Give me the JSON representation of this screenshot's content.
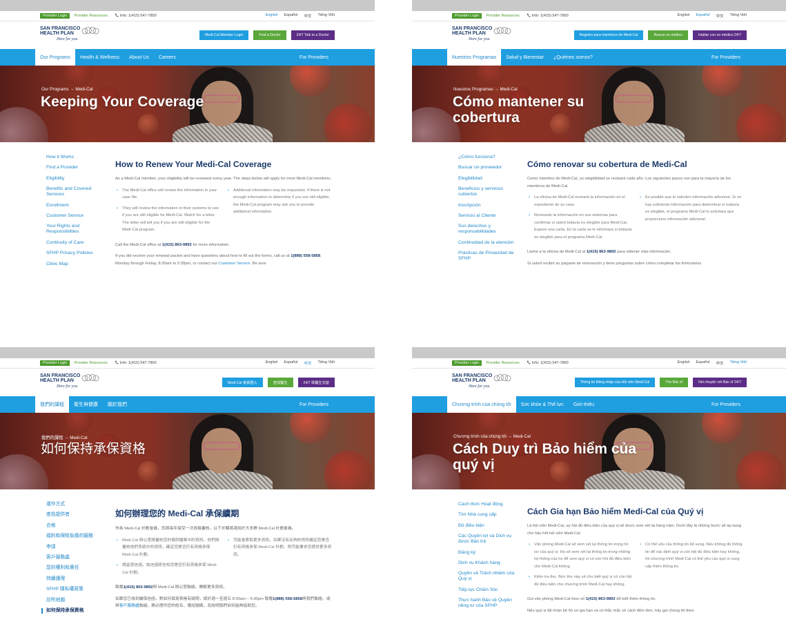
{
  "colors": {
    "brand_blue": "#1f9ee0",
    "brand_green": "#5aa83a",
    "brand_purple": "#5b2d86",
    "heading_navy": "#1b3a6b"
  },
  "icons": {
    "phone": "phone-icon",
    "logo": "sfhp-logo-icon"
  },
  "logo": {
    "line1": "SAN FRANCISCO",
    "line2": "HEALTH PLAN",
    "tagline": "Here for you"
  },
  "panels": [
    {
      "util": {
        "login": "Provider Login",
        "resources": "Provider Resources",
        "phone": "Info: 1(415) 547-7800",
        "langs": [
          "English",
          "Español",
          "中文",
          "Tiếng Việt"
        ],
        "active_lang": 0
      },
      "buttons": [
        "Medi-Cal Member Login",
        "Find a Doctor",
        "24/7 Talk to a Doctor"
      ],
      "nav": [
        "Our Programs",
        "Health & Wellness",
        "About Us",
        "Careers"
      ],
      "providers": "For Providers",
      "breadcrumb": "Our Programs → Medi-Cal",
      "title": "Keeping Your Coverage",
      "sidebar": [
        "How it Works",
        "Find a Provider",
        "Eligibility",
        "Benefits and Covered Services",
        "Enrollment",
        "Customer Service",
        "Your Rights and Responsibilities",
        "Continuity of Care",
        "SFHP Privacy Policies",
        "Clinic Map"
      ],
      "heading": "How to Renew Your Medi-Cal Coverage",
      "intro": "As a Medi-Cal member, your eligibility will be reviewed every year. The steps below will apply for most Medi-Cal members.",
      "bullets_left": [
        "The Medi-Cal office will review the information in your case file.",
        "They will review the information in their systems to see if you are still eligible for Medi-Cal. Watch for a letter. The letter will tell you if you are still eligible for the Medi-Cal program."
      ],
      "bullets_right": [
        "Additional information may be requested. If there is not enough information to determine if you are still eligible, the Medi-Cal program may ask you to provide additional information."
      ],
      "call_before": "Call the Medi-Cal office at ",
      "call_phone": "1(415) 863-9892",
      "call_after": " for more information.",
      "renew_before": "If you did receive your renewal packet and have questions about how to fill out the forms, call us at ",
      "renew_phone": "1(888) 558-5858",
      "renew_mid": ", Monday through Friday, 8:30am to 5:30pm, or contact our ",
      "renew_link": "Customer Service",
      "renew_after": ". Be sure"
    },
    {
      "util": {
        "login": "Provider Login",
        "resources": "Provider Resources",
        "phone": "Info: 1(415) 547-7800",
        "langs": [
          "English",
          "Español",
          "中文",
          "Tiếng Việt"
        ],
        "active_lang": 1
      },
      "buttons": [
        "Registro para miembros de Medi-Cal",
        "Buscar un médico",
        "Hablar con un médico 24/7"
      ],
      "nav": [
        "Nuestros Programas",
        "Salud y Bienestar",
        "¿Quiénes somos?"
      ],
      "providers": "For Providers",
      "breadcrumb": "Nuestros Programas → Medi-Cal",
      "title": "Cómo mantener su cobertura",
      "sidebar": [
        "¿Cómo funciona?",
        "Buscar un proveedor",
        "Elegibilidad",
        "Beneficios y servicios cubiertos",
        "Inscripción",
        "Servicio al Cliente",
        "Sus derechos y responsabilidades",
        "Continuidad de la atención",
        "Prácticas de Privacidad de SFHP"
      ],
      "heading": "Cómo renovar su cobertura de Medi-Cal",
      "intro": "Como miembro de Medi-Cal, su elegibilidad se revisará cada año. Los siguientes pasos son para la mayoría de los miembros de Medi-Cal.",
      "bullets_left": [
        "La oficina de Medi-Cal revisará la información en el expediente de su caso.",
        "Revisarán la información en sus sistemas para confirmar si usted todavía es elegible para Medi-Cal. Espere una carta. En la carta se le informará si todavía es elegible para el programa Medi-Cal."
      ],
      "bullets_right": [
        "Es posible que le soliciten información adicional. Si no hay suficiente información para determinar si todavía es elegible, el programa Medi-Cal le solicitará que proporcione información adicional."
      ],
      "call_before": "Llame a la oficina de Medi-Cal al ",
      "call_phone": "1(415) 863-9892",
      "call_after": " para obtener más información.",
      "renew_before": "Si usted recibió su paquete de renovación y tiene preguntas sobre cómo completar los formularios",
      "renew_phone": "",
      "renew_mid": "",
      "renew_link": "",
      "renew_after": ""
    },
    {
      "util": {
        "login": "Provider Login",
        "resources": "Provider Resources",
        "phone": "Info: 1(415) 547-7800",
        "langs": [
          "English",
          "Español",
          "中文",
          "Tiếng Việt"
        ],
        "active_lang": 2
      },
      "buttons": [
        "Medi-Cal 會員登入",
        "查找醫生",
        "24/7 與醫生交談"
      ],
      "nav": [
        "我們的課程",
        "衛生與健康",
        "關於我們"
      ],
      "providers": "For Providers",
      "breadcrumb": "我們的課程 → Medi-Cal",
      "title": "如何保持承保資格",
      "sidebar": [
        "運作方式",
        "查找提供者",
        "合格",
        "福利和保險負擔的服務",
        "申請",
        "客戶服務處",
        "您的權利和責任",
        "持續護理",
        "SFHP 隱私權政策",
        "診所地圖",
        "如何保持承保資格"
      ],
      "heading": "如何辦理您的 Medi-Cal 承保續期",
      "intro": "作為 Medi-Cal 計劃會員，您將每年接受一次資格審核。以下步驟將適用於大多數 Medi-Cal 計劃會員。",
      "bullets_left": [
        "Medi-Cal 辦公室將審核您的個例檔案中的資訊。他們將審核他們系統中的資訊，確定您是否仍有資格參保 Medi-Cal 計劃。",
        "請留意信函。該信函將告知您是否仍有資格參保 Medi-Cal 計劃。"
      ],
      "bullets_right": [
        "可能會索取更多資訊。如果沒有足夠的資訊確定您是否仍有資格參保 Medi-Cal 計劃，則可能要求您提供更多資訊。"
      ],
      "call_before": "致電",
      "call_phone": "1(415) 863-9892",
      "call_after": "與 Medi-Cal 辦公室聯絡，瞭解更多資訊。",
      "renew_before": "如果您已收到續保信函，對如何填寫表格有疑問，請於週一至週五 8:30am – 5:30pm 致電",
      "renew_phone": "1(888) 558-5858",
      "renew_mid": "與我們聯絡，或與",
      "renew_link": "客戶服務處",
      "renew_after": "聯絡。務必提供您的姓名、電話號碼，及說明我們如何能夠協助您。"
    },
    {
      "util": {
        "login": "Provider Login",
        "resources": "Provider Resources",
        "phone": "Info: 1(415) 547-7800",
        "langs": [
          "English",
          "Español",
          "中文",
          "Tiếng Việt"
        ],
        "active_lang": 3
      },
      "buttons": [
        "Thông tin Đăng nhập của Hội viên Medi-Cal",
        "Tìm Bác sĩ",
        "Nói chuyện với Bác sĩ 24/7"
      ],
      "nav": [
        "Chương trình của chúng tôi",
        "Sức khỏe & Thể lực",
        "Giới thiệu"
      ],
      "providers": "For Providers",
      "breadcrumb": "Chương trình của chúng tôi → Medi-Cal",
      "title": "Cách Duy trì Bảo hiểm của quý vị",
      "sidebar": [
        "Cách thức Hoạt động",
        "Tìm Nhà cung cấp",
        "Đủ điều kiện",
        "Các Quyền lợi và Dịch vụ được Bảo trả",
        "Đăng ký",
        "Dịch vụ Khách hàng",
        "Quyền và Trách nhiệm của Quý vị",
        "Tiếp tục Chăm Sóc",
        "Thực hành Bảo vệ Quyền riêng tư của SFHP"
      ],
      "heading": "Cách Gia hạn Bảo hiểm Medi-Cal của Quý vị",
      "intro": "Là hội viên Medi-Cal, sự hội đủ điều kiện của quý vị sẽ được xem xét lại hàng năm. Dưới đây là những bước sẽ áp dụng cho hầu hết hội viên Medi-Cal.",
      "bullets_left": [
        "Văn phòng Medi-Cal sẽ xem xét lại thông tin trong hồ sơ của quý vị. Họ sẽ xem xét lại thông tin trong những hệ thống của họ để xem quý vị có còn hội đủ điều kiện cho Medi-Cal không.",
        "Kiểm tra thư. Bức thư này sẽ cho biết quý vị có còn hội đủ điều kiện cho chương trình Medi-Cal hay không."
      ],
      "bullets_right": [
        "Có thể yêu cầu thông tin bổ sung. Nếu không đủ thông tin để xác định quý vị còn hội đủ điều kiện hay không, thì chương trình Medi-Cal có thể yêu cầu quý vị cung cấp thêm thông tin."
      ],
      "call_before": "Gọi văn phòng Medi-Cal theo số ",
      "call_phone": "1(415) 863-9892",
      "call_after": " để biết thêm thông tin.",
      "renew_before": "Nếu quý vị đã nhận bộ hồ sơ gia hạn và có thắc mắc về cách điền đơn, hãy gọi chúng tôi theo",
      "renew_phone": "",
      "renew_mid": "",
      "renew_link": "",
      "renew_after": ""
    }
  ]
}
